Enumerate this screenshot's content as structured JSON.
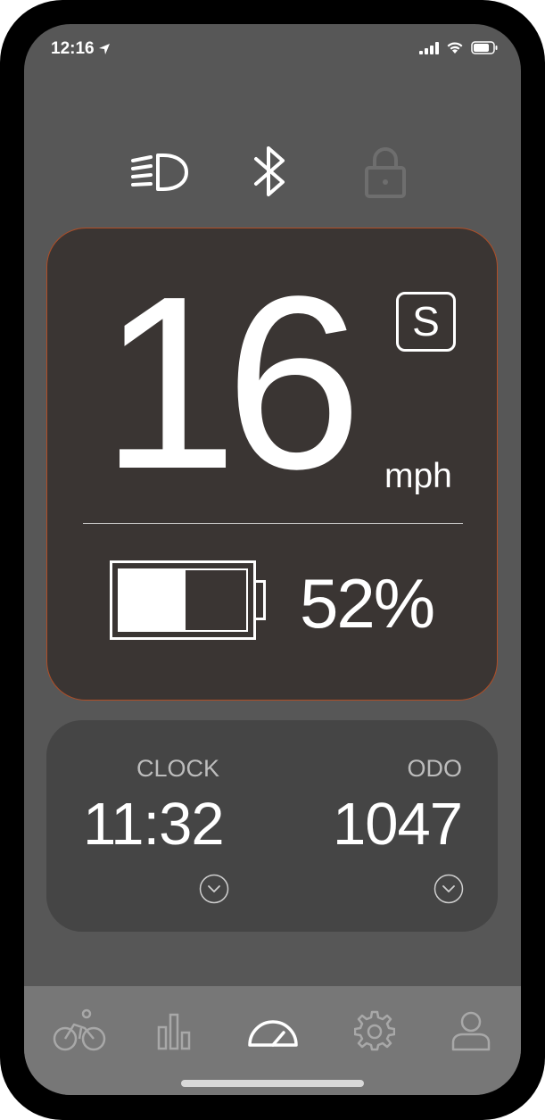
{
  "status_bar": {
    "time": "12:16"
  },
  "top_icons": [
    "headlight-icon",
    "bluetooth-icon",
    "lock-icon"
  ],
  "speed_card": {
    "speed": "16",
    "mode": "S",
    "unit": "mph",
    "battery_percent_text": "52%",
    "battery_level": 0.52
  },
  "info_card": {
    "clock_label": "CLOCK",
    "clock_value": "11:32",
    "odo_label": "ODO",
    "odo_value": "1047"
  },
  "bottom_nav": {
    "items": [
      "ride-icon",
      "stats-icon",
      "dashboard-icon",
      "settings-icon",
      "profile-icon"
    ],
    "active": "dashboard-icon"
  },
  "colors": {
    "screen_bg": "#575757",
    "card_bg": "#3a3533",
    "card_border": "#b14e26",
    "info_bg": "#454545",
    "nav_bg": "#777777",
    "text": "#ffffff",
    "muted": "#bcbcbc"
  }
}
